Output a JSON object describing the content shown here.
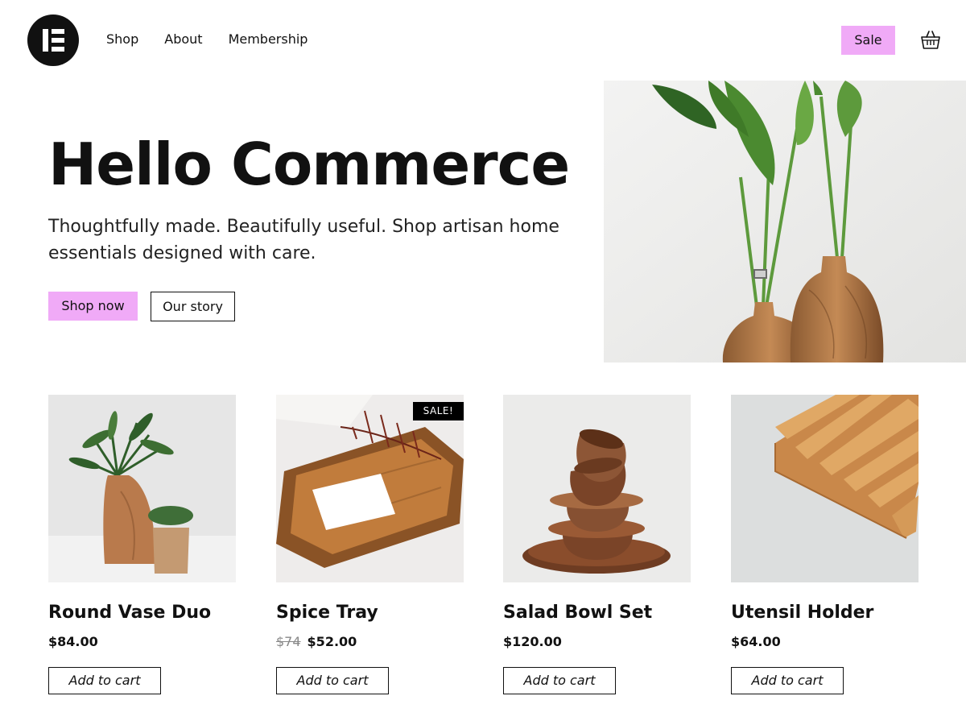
{
  "header": {
    "nav": [
      "Shop",
      "About",
      "Membership"
    ],
    "sale_label": "Sale",
    "icons": {
      "logo": "elementor-logo-icon",
      "cart": "basket-icon"
    }
  },
  "hero": {
    "title": "Hello Commerce",
    "subtitle": "Thoughtfully made. Beautifully useful. Shop artisan home essentials designed with care.",
    "primary_button": "Shop now",
    "secondary_button": "Our story"
  },
  "products": [
    {
      "name": "Round Vase Duo",
      "price": "$84.00",
      "button": "Add to cart"
    },
    {
      "name": "Spice Tray",
      "old_price": "$74",
      "price": "$52.00",
      "badge": "SALE!",
      "button": "Add to cart"
    },
    {
      "name": "Salad Bowl Set",
      "price": "$120.00",
      "button": "Add to cart"
    },
    {
      "name": "Utensil Holder",
      "price": "$64.00",
      "button": "Add to cart"
    }
  ],
  "colors": {
    "accent": "#f0aaf7",
    "text": "#111111",
    "badge_bg": "#000000"
  }
}
